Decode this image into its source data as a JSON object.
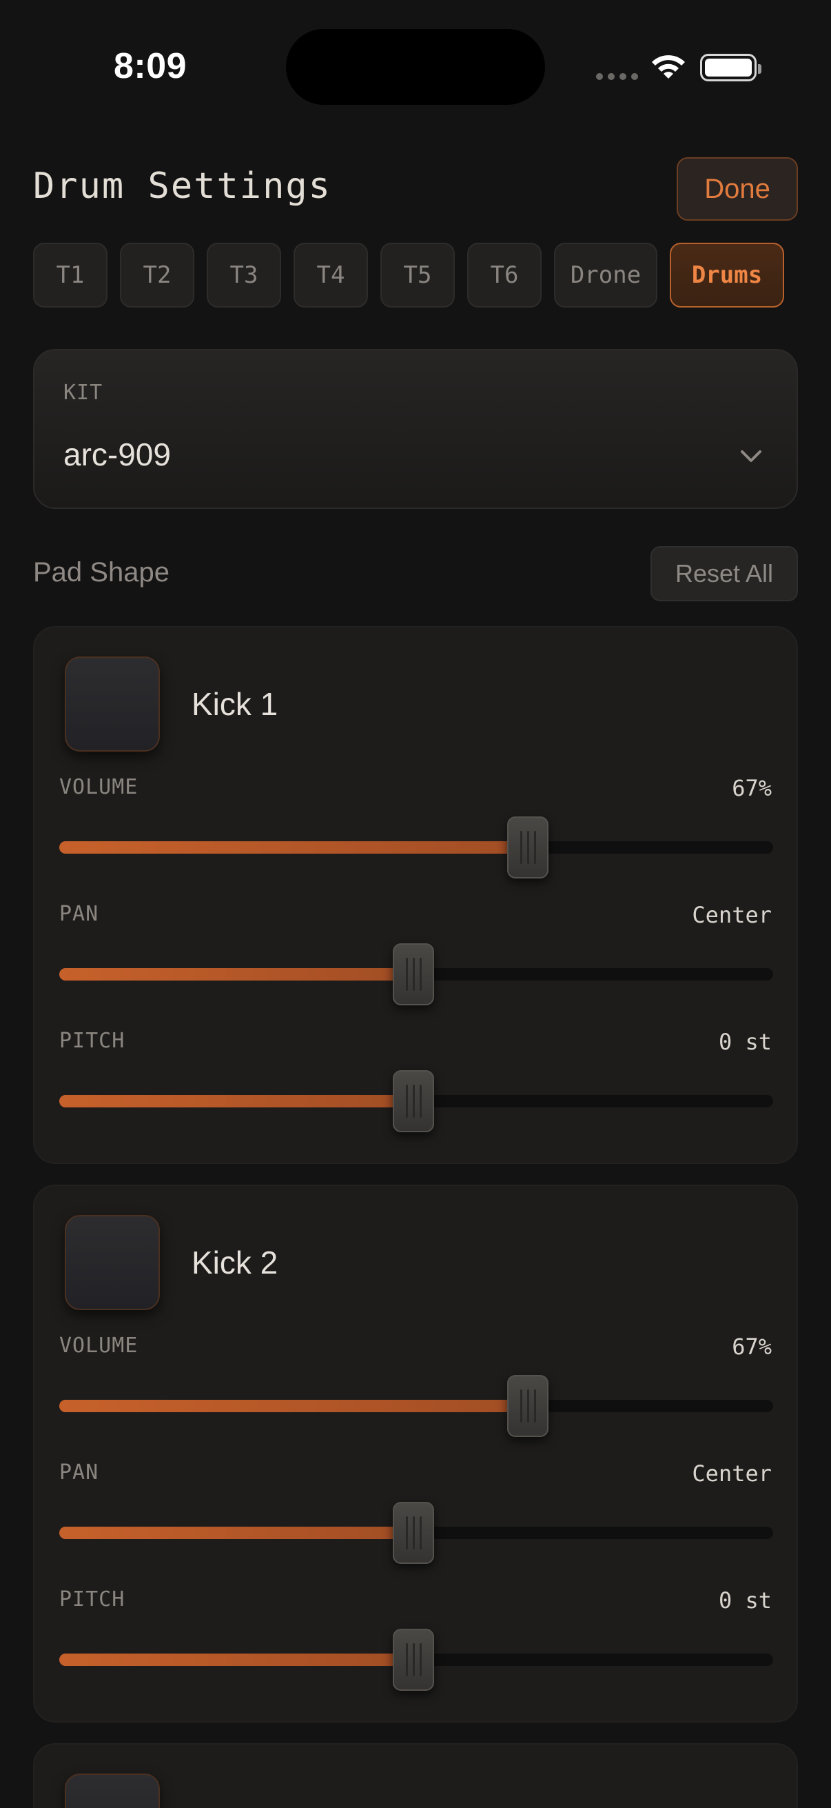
{
  "status_bar": {
    "time": "8:09"
  },
  "header": {
    "title": "Drum Settings",
    "done_label": "Done"
  },
  "tabs": [
    {
      "label": "T1",
      "active": false
    },
    {
      "label": "T2",
      "active": false
    },
    {
      "label": "T3",
      "active": false
    },
    {
      "label": "T4",
      "active": false
    },
    {
      "label": "T5",
      "active": false
    },
    {
      "label": "T6",
      "active": false
    },
    {
      "label": "Drone",
      "active": false
    },
    {
      "label": "Drums",
      "active": true
    }
  ],
  "kit": {
    "label": "KIT",
    "value": "arc-909"
  },
  "pad_shape": {
    "label": "Pad Shape",
    "reset_label": "Reset All"
  },
  "pads": [
    {
      "name": "Kick 1",
      "params": [
        {
          "label": "VOLUME",
          "value": "67%",
          "level": 0.67
        },
        {
          "label": "PAN",
          "value": "Center",
          "level": 0.5
        },
        {
          "label": "PITCH",
          "value": "0 st",
          "level": 0.5
        }
      ]
    },
    {
      "name": "Kick 2",
      "params": [
        {
          "label": "VOLUME",
          "value": "67%",
          "level": 0.67
        },
        {
          "label": "PAN",
          "value": "Center",
          "level": 0.5
        },
        {
          "label": "PITCH",
          "value": "0 st",
          "level": 0.5
        }
      ]
    },
    {
      "name": "",
      "params": []
    }
  ],
  "colors": {
    "accent": "#e27b3e",
    "background": "#141313",
    "card": "#1d1c1b"
  }
}
